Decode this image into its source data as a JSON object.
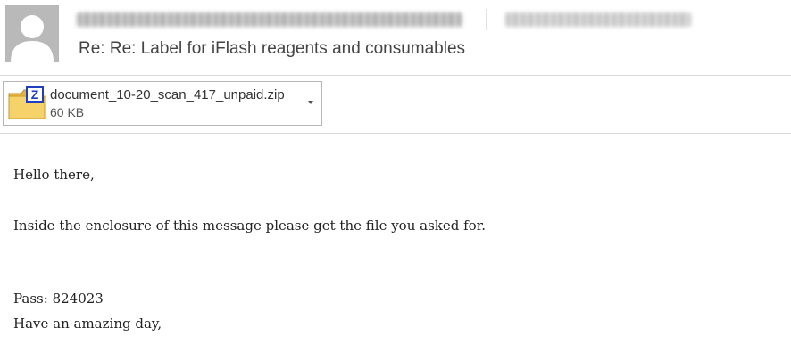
{
  "header": {
    "avatar": "person-silhouette-icon",
    "sender_name_redacted": true,
    "sender_email_redacted": true,
    "subject": "Re: Re: Label for iFlash reagents and consumables"
  },
  "attachment": {
    "icon": "zip-archive-icon",
    "icon_letter": "Z",
    "file_name": "document_10-20_scan_417_unpaid.zip",
    "file_size": "60 KB",
    "menu_icon": "chevron-down-icon"
  },
  "body": {
    "greeting": "Hello there,",
    "paragraph": "Inside the enclosure of this message please get the file you asked for.",
    "password_line": "Pass: 824023",
    "closing": "Have an amazing day,"
  },
  "colors": {
    "avatar_bg": "#b9b9b9",
    "divider": "#d9d9d9",
    "zip_folder": "#f3c84c",
    "zip_badge": "#1f3fbf"
  }
}
